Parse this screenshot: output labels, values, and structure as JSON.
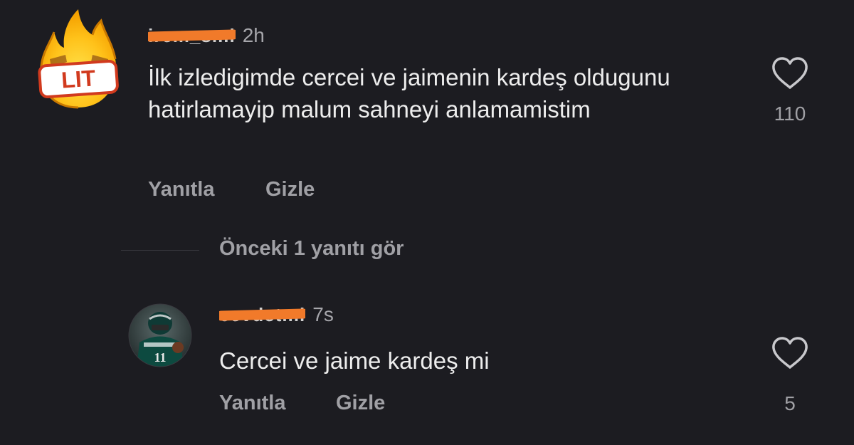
{
  "main_comment": {
    "username": "irem_s...i",
    "time": "2h",
    "text": "İlk izledigimde cercei ve jaimenin kardeş oldugunu hatirlamayip malum sahneyi anlamamistim",
    "reply_label": "Yanıtla",
    "hide_label": "Gizle",
    "likes": "110",
    "avatar_badge": "LIT"
  },
  "view_previous_label": "Önceki 1 yanıtı gör",
  "reply_comment": {
    "username": "cevdet...l",
    "time": "7s",
    "text": "Cercei ve jaime kardeş mi",
    "reply_label": "Yanıtla",
    "hide_label": "Gizle",
    "likes": "5",
    "avatar_jersey": "11"
  },
  "colors": {
    "background": "#1c1c21",
    "redaction": "#f17a2a",
    "primary_text": "#ededed",
    "secondary_text": "#a0a0a5"
  }
}
